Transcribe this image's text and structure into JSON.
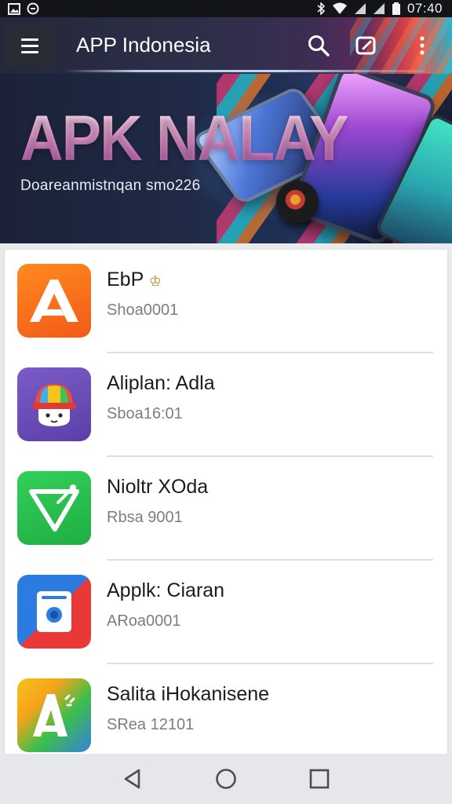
{
  "status_bar": {
    "time": "07:40",
    "left_icons": [
      "gallery-icon",
      "message-icon"
    ],
    "right_icons": [
      "bluetooth-icon",
      "wifi-icon",
      "signal-icon",
      "signal-icon",
      "battery-icon"
    ]
  },
  "app_bar": {
    "title": "APP Indonesia",
    "icons": [
      "menu-icon",
      "search-icon",
      "edit-icon",
      "more-icon"
    ],
    "colors": {
      "base": "#24283a",
      "accent_stripes": "#e8574a"
    }
  },
  "banner": {
    "title": "APK NALAY",
    "subtitle": "Doareanmistnqan smo226"
  },
  "app_list": {
    "items": [
      {
        "name": "EbP",
        "badge_icon": "crown-icon",
        "sub": "Shoa0001",
        "icon": "letter-a-icon",
        "icon_color": "#f25a18"
      },
      {
        "name": "Aliplan: Adla",
        "sub": "Sboa16:01",
        "icon": "mascot-icon",
        "icon_color": "#5b3fa8"
      },
      {
        "name": "Nioltr XOda",
        "sub": "Rbsa 9001",
        "icon": "shield-v-icon",
        "icon_color": "#1fae42"
      },
      {
        "name": "Applk: Ciaran",
        "sub": "ARoa0001",
        "icon": "washer-icon",
        "icon_color": "#2b7be0"
      },
      {
        "name": "Salita iHokanisene",
        "sub": "SRea 12101",
        "icon": "letter-a-icon",
        "icon_color": "#f4c21a"
      }
    ]
  },
  "nav_bar": {
    "buttons": [
      "back-icon",
      "home-icon",
      "recents-icon"
    ]
  }
}
